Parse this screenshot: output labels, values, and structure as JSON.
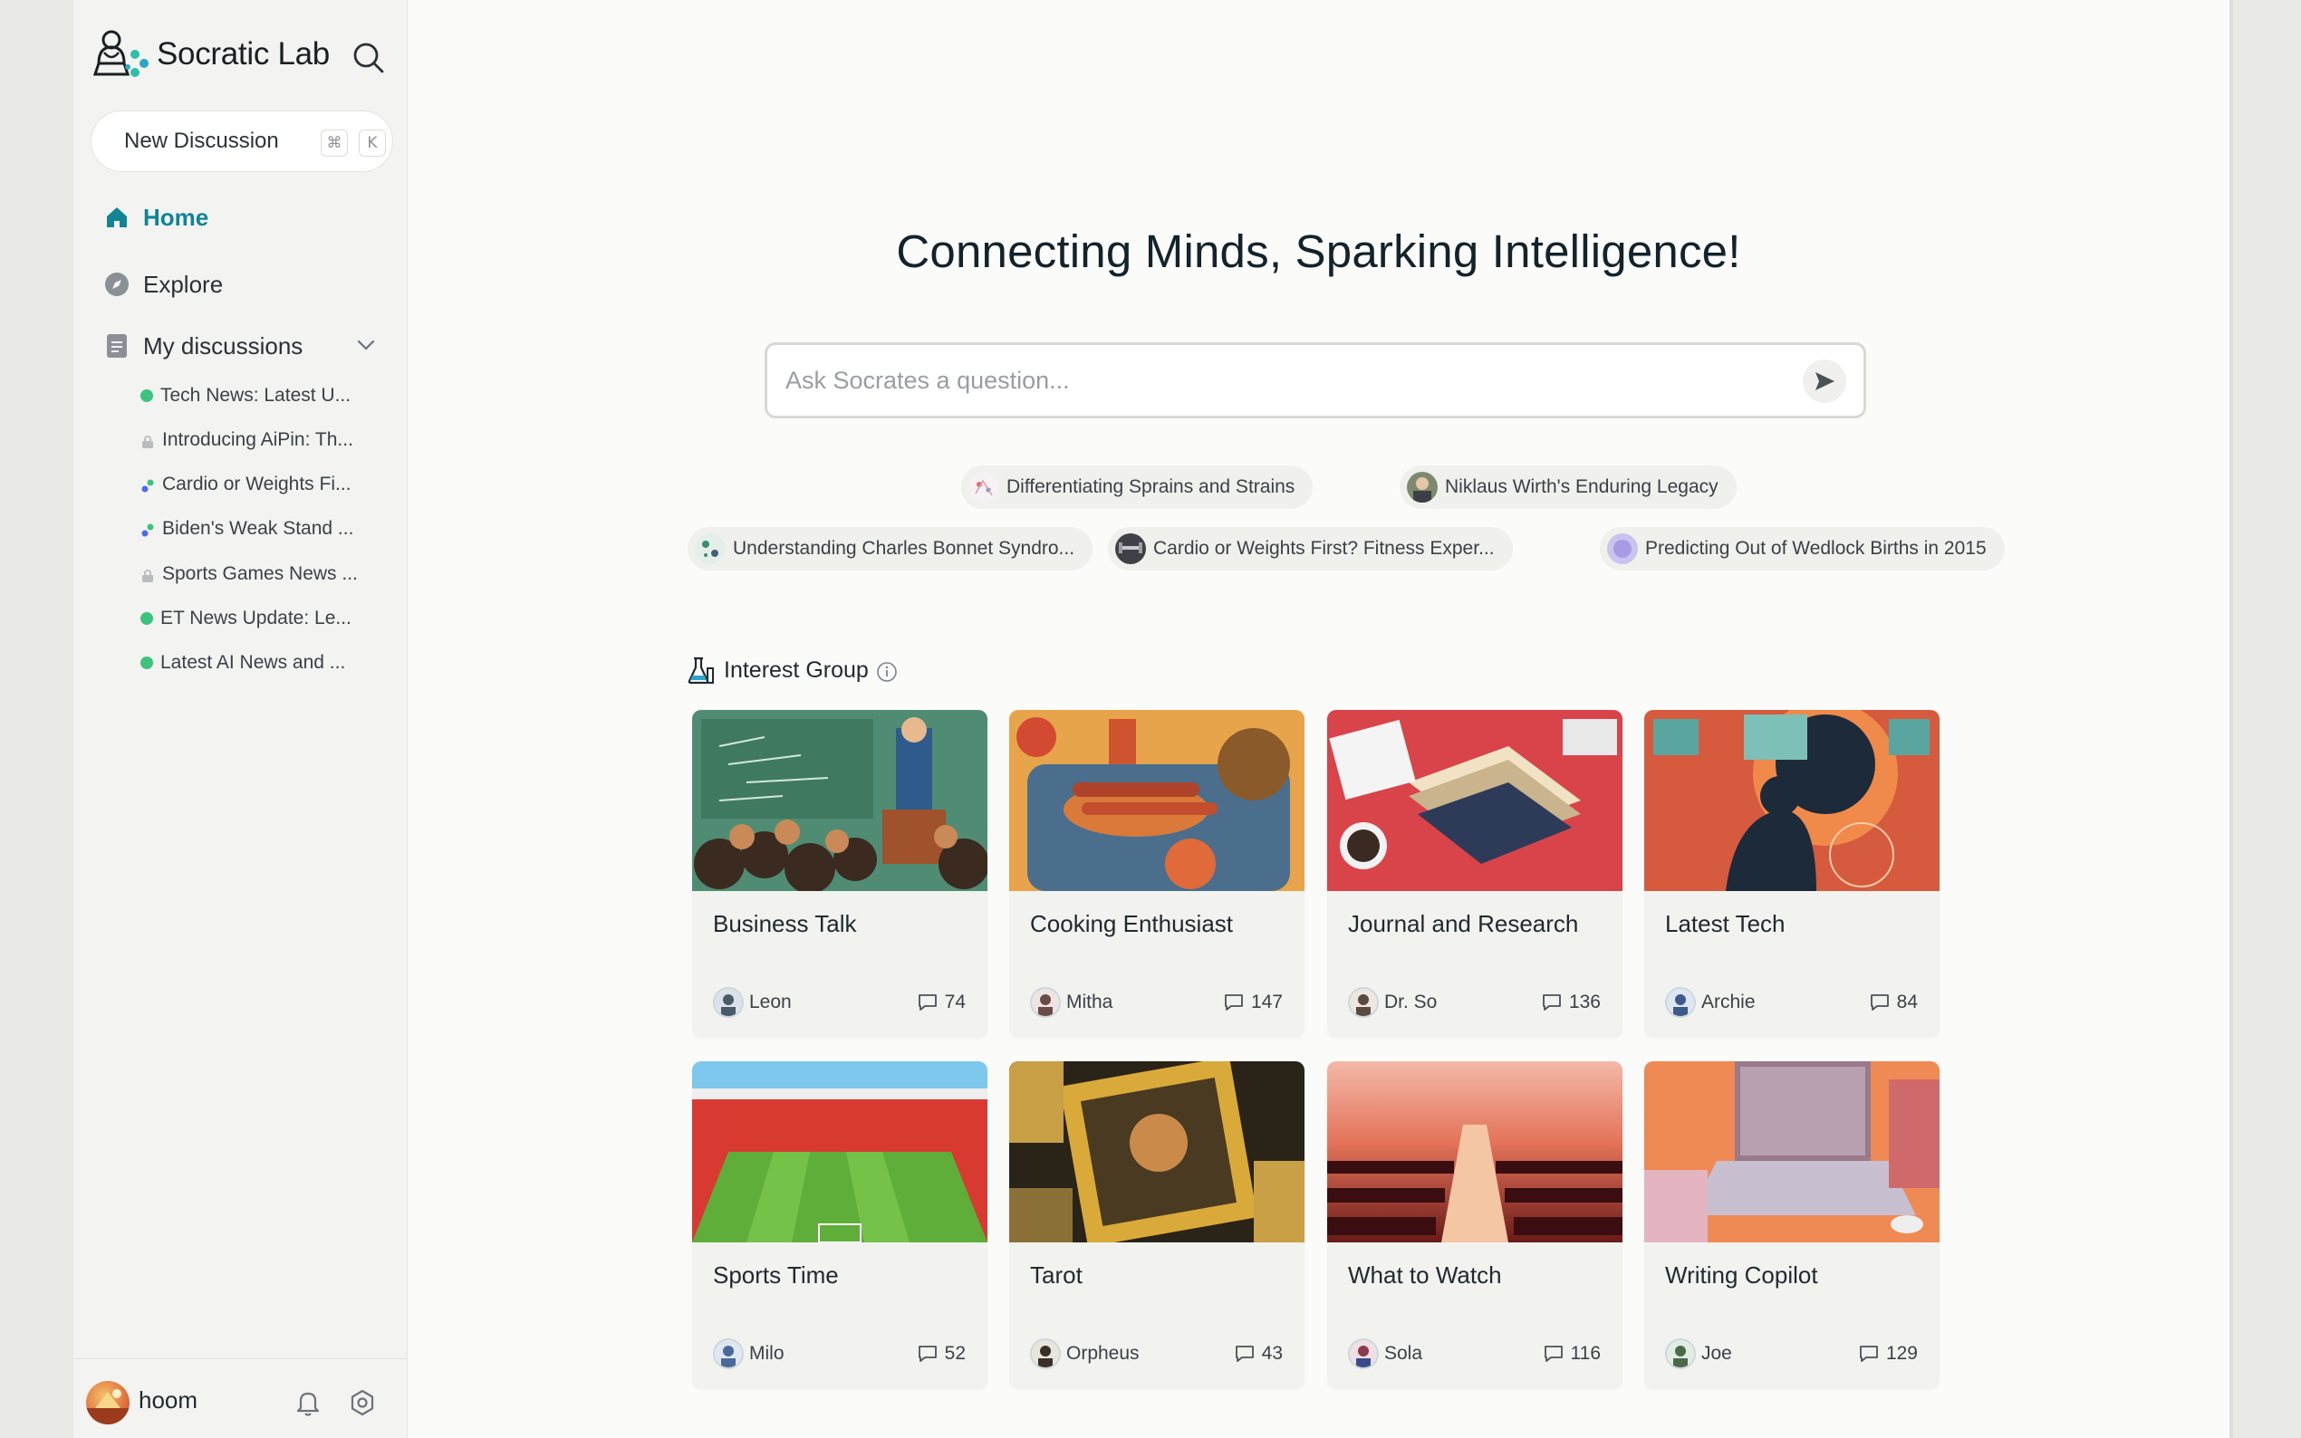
{
  "app": {
    "logo_text": "Socratic Lab"
  },
  "sidebar": {
    "new_discussion": {
      "label": "New Discussion",
      "shortcut_mod": "⌘",
      "shortcut_key": "K"
    },
    "nav": [
      {
        "label": "Home",
        "icon": "home-icon",
        "active": true
      },
      {
        "label": "Explore",
        "icon": "compass-icon",
        "active": false
      }
    ],
    "my_discussions": {
      "label": "My discussions",
      "items": [
        {
          "label": "Tech News: Latest U...",
          "status": "green-dot"
        },
        {
          "label": "Introducing AiPin: Th...",
          "status": "lock-icon"
        },
        {
          "label": "Cardio or Weights Fi...",
          "status": "multi-dot"
        },
        {
          "label": "Biden's Weak Stand ...",
          "status": "multi-dot"
        },
        {
          "label": "Sports Games News ...",
          "status": "lock-icon"
        },
        {
          "label": "ET News Update: Le...",
          "status": "green-dot"
        },
        {
          "label": "Latest AI News and ...",
          "status": "green-dot"
        }
      ]
    },
    "user": {
      "name": "hoom"
    }
  },
  "main": {
    "headline": "Connecting Minds, Sparking Intelligence!",
    "ask": {
      "placeholder": "Ask Socrates a question..."
    },
    "suggestions_row1": [
      "Differentiating Sprains and Strains",
      "Niklaus Wirth's Enduring Legacy"
    ],
    "suggestions_row2": [
      "Understanding Charles Bonnet Syndro...",
      "Cardio or Weights First? Fitness Exper...",
      "Predicting Out of Wedlock Births in 2015"
    ],
    "interest_group": {
      "title": "Interest Group",
      "cards": [
        {
          "title": "Business Talk",
          "owner": "Leon",
          "count": "74"
        },
        {
          "title": "Cooking Enthusiast",
          "owner": "Mitha",
          "count": "147"
        },
        {
          "title": "Journal and Research",
          "owner": "Dr. So",
          "count": "136"
        },
        {
          "title": "Latest Tech",
          "owner": "Archie",
          "count": "84"
        },
        {
          "title": "Sports Time",
          "owner": "Milo",
          "count": "52"
        },
        {
          "title": "Tarot",
          "owner": "Orpheus",
          "count": "43"
        },
        {
          "title": "What to Watch",
          "owner": "Sola",
          "count": "116"
        },
        {
          "title": "Writing Copilot",
          "owner": "Joe",
          "count": "129"
        }
      ]
    }
  },
  "colors": {
    "accent": "#128595",
    "status_green": "#3cc47c",
    "background": "#fbfbf9",
    "sidebar": "#f3f3f1"
  }
}
